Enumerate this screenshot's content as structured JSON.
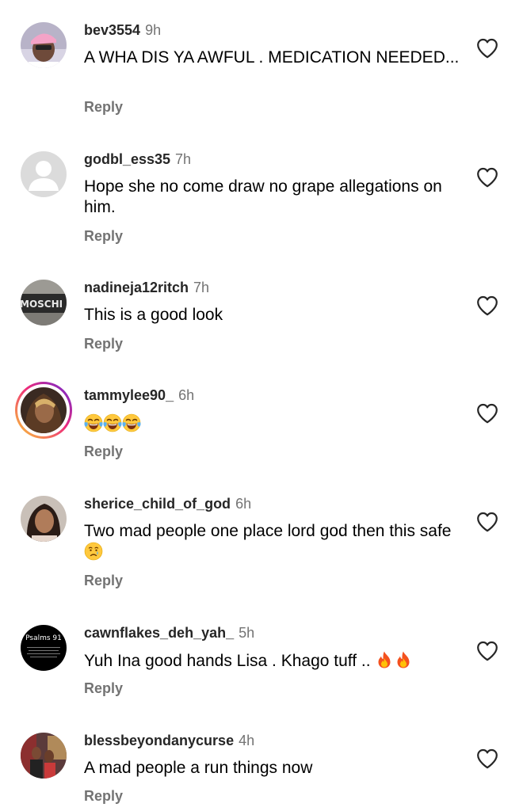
{
  "colors": {
    "username": "#262626",
    "timestamp": "#737373",
    "reply": "#737373",
    "text": "#000000",
    "background": "#ffffff"
  },
  "comments": [
    {
      "username": "bev3554",
      "time": "9h",
      "text": "A WHA DIS YA AWFUL . MEDICATION NEEDED...",
      "reply_label": "Reply",
      "avatar": "profile-photo",
      "like_icon": "heart-outline-icon"
    },
    {
      "username": "godbl_ess35",
      "time": "7h",
      "text": "Hope she no come draw no grape allegations on him.",
      "reply_label": "Reply",
      "avatar": "default-profile-icon",
      "like_icon": "heart-outline-icon"
    },
    {
      "username": "nadineja12ritch",
      "time": "7h",
      "text": "This is a good look",
      "reply_label": "Reply",
      "avatar": "profile-photo",
      "avatar_text": "MOSCHI",
      "like_icon": "heart-outline-icon"
    },
    {
      "username": "tammylee90_",
      "time": "6h",
      "text": "",
      "emoji": [
        "face-with-tears-of-joy",
        "face-with-tears-of-joy",
        "face-with-tears-of-joy"
      ],
      "reply_label": "Reply",
      "avatar": "profile-photo-with-story-ring",
      "like_icon": "heart-outline-icon"
    },
    {
      "username": "sherice_child_of_god",
      "time": "6h",
      "text": "Two mad people one place lord god then this safe",
      "emoji": [
        "sad-but-relieved-face"
      ],
      "reply_label": "Reply",
      "avatar": "profile-photo",
      "like_icon": "heart-outline-icon"
    },
    {
      "username": "cawnflakes_deh_yah_",
      "time": "5h",
      "text": "Yuh Ina good hands Lisa . Khago tuff ..",
      "emoji": [
        "fire",
        "fire"
      ],
      "reply_label": "Reply",
      "avatar": "profile-photo",
      "avatar_text": "Psalms 91",
      "like_icon": "heart-outline-icon"
    },
    {
      "username": "blessbeyondanycurse",
      "time": "4h",
      "text": "A mad people a run things now",
      "reply_label": "Reply",
      "avatar": "profile-photo",
      "like_icon": "heart-outline-icon"
    }
  ]
}
